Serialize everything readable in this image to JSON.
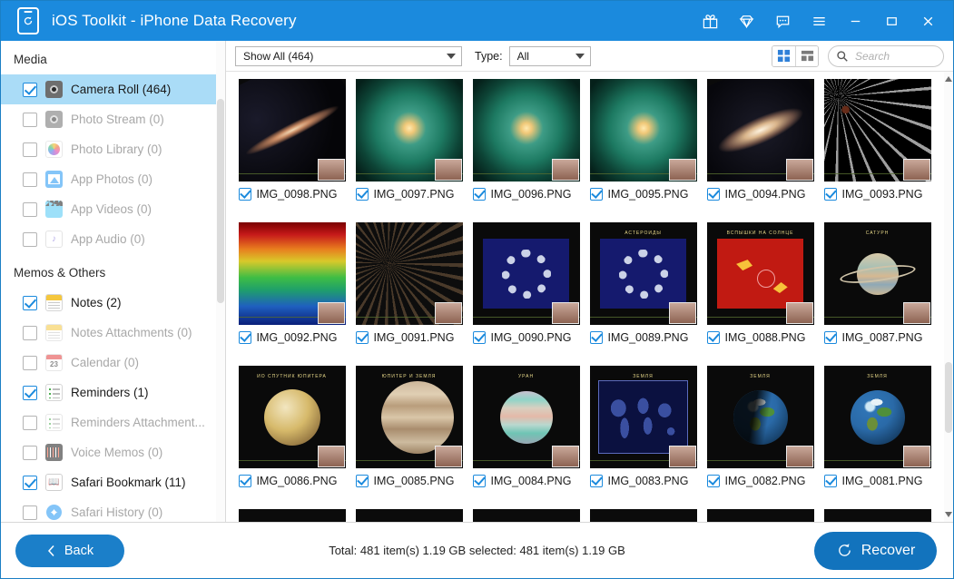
{
  "window": {
    "title": "iOS Toolkit - iPhone Data Recovery",
    "logo_icon": "iphone-restore-icon",
    "accent_color": "#1b8add",
    "titlebar_buttons": [
      {
        "name": "gift-icon",
        "label": ""
      },
      {
        "name": "gem-icon",
        "label": ""
      },
      {
        "name": "chat-icon",
        "label": ""
      },
      {
        "name": "menu-icon",
        "label": ""
      },
      {
        "name": "minimize-icon",
        "label": ""
      },
      {
        "name": "maximize-icon",
        "label": ""
      },
      {
        "name": "close-icon",
        "label": ""
      }
    ]
  },
  "sidebar": {
    "groups": [
      {
        "title": "Media",
        "items": [
          {
            "label": "Camera Roll (464)",
            "icon": "camera-icon",
            "checked": true,
            "selected": true,
            "enabled": true
          },
          {
            "label": "Photo Stream (0)",
            "icon": "camera-icon",
            "checked": false,
            "selected": false,
            "enabled": false
          },
          {
            "label": "Photo Library (0)",
            "icon": "photo-library-icon",
            "checked": false,
            "selected": false,
            "enabled": false
          },
          {
            "label": "App Photos (0)",
            "icon": "app-photos-icon",
            "checked": false,
            "selected": false,
            "enabled": false
          },
          {
            "label": "App Videos (0)",
            "icon": "app-videos-icon",
            "checked": false,
            "selected": false,
            "enabled": false
          },
          {
            "label": "App Audio (0)",
            "icon": "app-audio-icon",
            "checked": false,
            "selected": false,
            "enabled": false
          }
        ]
      },
      {
        "title": "Memos & Others",
        "items": [
          {
            "label": "Notes (2)",
            "icon": "notes-icon",
            "checked": true,
            "selected": false,
            "enabled": true
          },
          {
            "label": "Notes Attachments (0)",
            "icon": "notes-icon",
            "checked": false,
            "selected": false,
            "enabled": false
          },
          {
            "label": "Calendar (0)",
            "icon": "calendar-icon",
            "checked": false,
            "selected": false,
            "enabled": false
          },
          {
            "label": "Reminders (1)",
            "icon": "reminders-icon",
            "checked": true,
            "selected": false,
            "enabled": true
          },
          {
            "label": "Reminders Attachment...",
            "icon": "reminders-icon",
            "checked": false,
            "selected": false,
            "enabled": false
          },
          {
            "label": "Voice Memos (0)",
            "icon": "voice-memos-icon",
            "checked": false,
            "selected": false,
            "enabled": false
          },
          {
            "label": "Safari Bookmark (11)",
            "icon": "safari-bookmark-icon",
            "checked": true,
            "selected": false,
            "enabled": true
          },
          {
            "label": "Safari History (0)",
            "icon": "safari-history-icon",
            "checked": false,
            "selected": false,
            "enabled": false
          }
        ]
      }
    ]
  },
  "toolbar": {
    "show_filter_value": "Show All (464)",
    "type_label": "Type:",
    "type_value": "All",
    "view_grid_icon": "grid-view-icon",
    "view_list_icon": "list-view-icon",
    "active_view": "grid",
    "search_icon": "search-icon",
    "search_value": "",
    "search_placeholder": "Search"
  },
  "grid": {
    "items": [
      {
        "name": "IMG_0098.PNG",
        "checked": true,
        "art": "galaxy-edge",
        "caption": ""
      },
      {
        "name": "IMG_0097.PNG",
        "checked": true,
        "art": "galaxy-green",
        "caption": ""
      },
      {
        "name": "IMG_0096.PNG",
        "checked": true,
        "art": "galaxy-green",
        "caption": ""
      },
      {
        "name": "IMG_0095.PNG",
        "checked": true,
        "art": "galaxy-green",
        "caption": ""
      },
      {
        "name": "IMG_0094.PNG",
        "checked": true,
        "art": "galaxy-andromeda",
        "caption": ""
      },
      {
        "name": "IMG_0093.PNG",
        "checked": true,
        "art": "starfield",
        "caption": ""
      },
      {
        "name": "IMG_0092.PNG",
        "checked": true,
        "art": "rainbow",
        "caption": ""
      },
      {
        "name": "IMG_0091.PNG",
        "checked": true,
        "art": "cluster",
        "caption": ""
      },
      {
        "name": "IMG_0090.PNG",
        "checked": true,
        "art": "slide-ring",
        "caption": ""
      },
      {
        "name": "IMG_0089.PNG",
        "checked": true,
        "art": "slide-asteroids",
        "caption": "АСТЕРОИДЫ"
      },
      {
        "name": "IMG_0088.PNG",
        "checked": true,
        "art": "slide-flare",
        "caption": "ВСПЫШКИ НА СОЛНЦЕ"
      },
      {
        "name": "IMG_0087.PNG",
        "checked": true,
        "art": "slide-saturn",
        "caption": "САТУРН"
      },
      {
        "name": "IMG_0086.PNG",
        "checked": true,
        "art": "slide-io",
        "caption": "ИО СПУТНИК ЮПИТЕРА"
      },
      {
        "name": "IMG_0085.PNG",
        "checked": true,
        "art": "slide-jupiter",
        "caption": "ЮПИТЕР И ЗЕМЛЯ"
      },
      {
        "name": "IMG_0084.PNG",
        "checked": true,
        "art": "slide-uranus",
        "caption": "УРАН"
      },
      {
        "name": "IMG_0083.PNG",
        "checked": true,
        "art": "slide-worldmap",
        "caption": "ЗЕМЛЯ"
      },
      {
        "name": "IMG_0082.PNG",
        "checked": true,
        "art": "slide-earth-shadow",
        "caption": "ЗЕМЛЯ"
      },
      {
        "name": "IMG_0081.PNG",
        "checked": true,
        "art": "slide-earth",
        "caption": "ЗЕМЛЯ"
      }
    ],
    "partial_row_count": 6
  },
  "footer": {
    "back_label": "Back",
    "back_icon": "chevron-left-icon",
    "status_text": "Total: 481 item(s) 1.19 GB   selected: 481 item(s) 1.19 GB",
    "recover_label": "Recover",
    "recover_icon": "restore-icon"
  }
}
